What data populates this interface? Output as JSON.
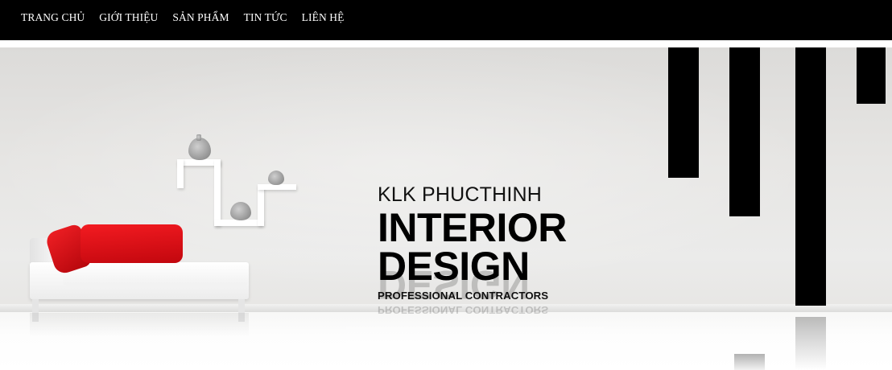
{
  "nav": {
    "items": [
      {
        "label": "TRANG CHỦ"
      },
      {
        "label": "GIỚI THIỆU"
      },
      {
        "label": "SẢN PHẨM"
      },
      {
        "label": "TIN TỨC"
      },
      {
        "label": "LIÊN HỆ"
      }
    ]
  },
  "hero": {
    "brand_name": "KLK PHUCTHINH",
    "headline_line1": "INTERIOR",
    "headline_line2": "DESIGN",
    "tagline": "PROFESSIONAL CONTRACTORS"
  },
  "colors": {
    "nav_background": "#000000",
    "nav_text": "#ffffff",
    "accent_red": "#e3141a",
    "stripe_black": "#000000"
  }
}
